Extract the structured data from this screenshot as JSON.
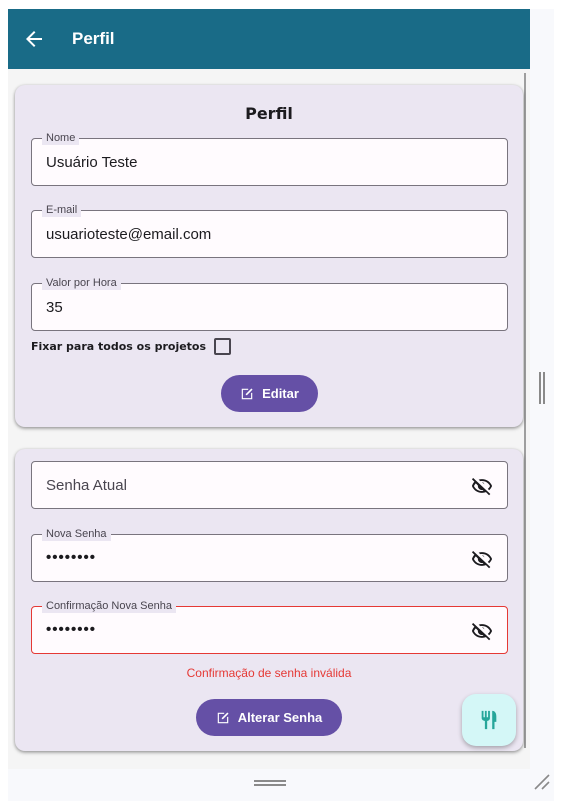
{
  "appbar": {
    "title": "Perfil",
    "back_icon": "arrow-left-icon",
    "color": "#196b87"
  },
  "profile_card": {
    "title": "Perfil",
    "fields": {
      "name": {
        "label": "Nome",
        "value": "Usuário Teste"
      },
      "email": {
        "label": "E-mail",
        "value": "usuarioteste@email.com"
      },
      "hourly_rate": {
        "label": "Valor por Hora",
        "value": "35"
      }
    },
    "fix_all_projects": {
      "label": "Fixar para todos os projetos",
      "checked": false
    },
    "edit_button": {
      "label": "Editar",
      "icon": "edit-icon"
    }
  },
  "password_card": {
    "current_password": {
      "placeholder": "Senha Atual",
      "icon": "eye-off-icon"
    },
    "new_password": {
      "label": "Nova Senha",
      "value": "••••••••",
      "icon": "eye-off-icon"
    },
    "confirm_password": {
      "label": "Confirmação Nova Senha",
      "value": "••••••••",
      "icon": "eye-off-icon"
    },
    "error": "Confirmação de senha inválida",
    "change_button": {
      "label": "Alterar Senha",
      "icon": "edit-icon"
    }
  },
  "fab": {
    "icon": "restaurant-icon"
  },
  "colors": {
    "accent": "#6550a6",
    "error": "#e53935",
    "card": "#ebe6f2",
    "fab": "#d4f7f7"
  }
}
